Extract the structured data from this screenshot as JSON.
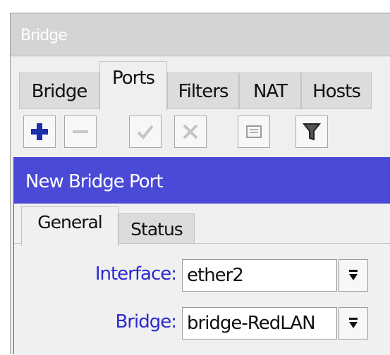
{
  "window": {
    "title": "Bridge"
  },
  "tabs": [
    {
      "label": "Bridge"
    },
    {
      "label": "Ports"
    },
    {
      "label": "Filters"
    },
    {
      "label": "NAT"
    },
    {
      "label": "Hosts"
    }
  ],
  "toolbar": {
    "add_icon": "plus-icon",
    "remove_icon": "minus-icon",
    "enable_icon": "check-icon",
    "disable_icon": "x-icon",
    "comment_icon": "note-icon",
    "filter_icon": "filter-icon"
  },
  "dialog": {
    "title": "New Bridge Port",
    "tabs": [
      {
        "label": "General"
      },
      {
        "label": "Status"
      }
    ],
    "fields": [
      {
        "label": "Interface",
        "colon": ":",
        "value": "ether2"
      },
      {
        "label": "Bridge",
        "colon": ":",
        "value": "bridge-RedLAN"
      }
    ]
  },
  "colors": {
    "accent": "#4a4ad6",
    "label": "#2a2ad0",
    "add": "#1a2fa8"
  }
}
